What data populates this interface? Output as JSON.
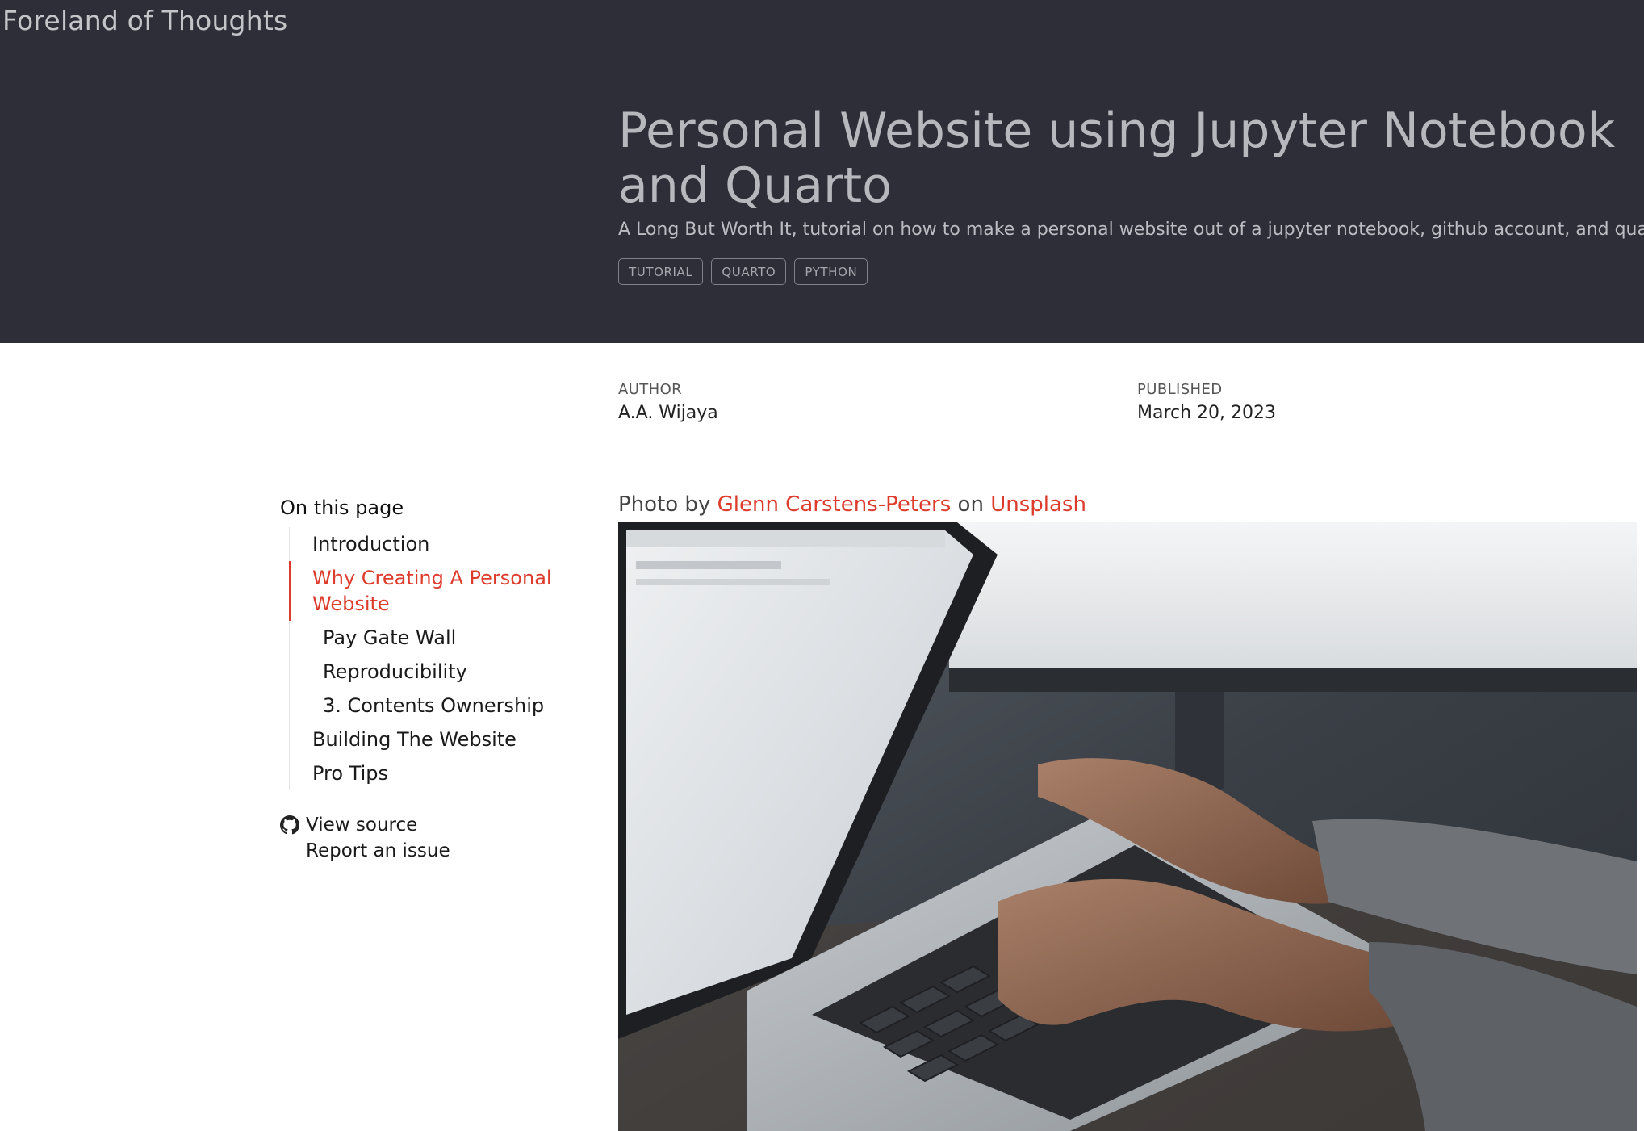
{
  "site": {
    "title": "Foreland of Thoughts"
  },
  "post": {
    "title": "Personal Website using Jupyter Notebook and Quarto",
    "subtitle": "A Long But Worth It, tutorial on how to make a personal website out of a jupyter notebook, github account, and quarto.",
    "tags": [
      "TUTORIAL",
      "QUARTO",
      "PYTHON"
    ]
  },
  "meta": {
    "author_label": "AUTHOR",
    "author": "A.A. Wijaya",
    "published_label": "PUBLISHED",
    "published": "March 20, 2023"
  },
  "toc": {
    "heading": "On this page",
    "items": [
      {
        "label": "Introduction",
        "level": 1,
        "active": false
      },
      {
        "label": "Why Creating A Personal Website",
        "level": 1,
        "active": true
      },
      {
        "label": "Pay Gate Wall",
        "level": 2,
        "active": false
      },
      {
        "label": "Reproducibility",
        "level": 2,
        "active": false
      },
      {
        "label": "3. Contents Ownership",
        "level": 2,
        "active": false
      },
      {
        "label": "Building The Website",
        "level": 1,
        "active": false
      },
      {
        "label": "Pro Tips",
        "level": 1,
        "active": false
      }
    ],
    "view_source": "View source",
    "report_issue": "Report an issue",
    "github_icon": "github-icon"
  },
  "content": {
    "caption_prefix": "Photo by",
    "photographer": "Glenn Carstens-Peters",
    "caption_mid": "on",
    "source": "Unsplash"
  },
  "colors": {
    "header_bg": "#2d2e38",
    "accent": "#dd3b2c"
  }
}
